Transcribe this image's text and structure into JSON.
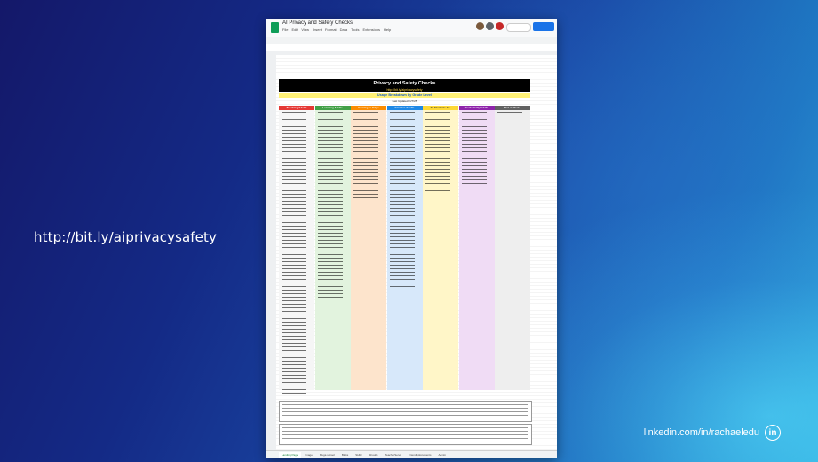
{
  "slide": {
    "link_text": "http://bit.ly/aiprivacysafety",
    "linkedin_text": "linkedin.com/in/rachaeledu",
    "linkedin_icon": "in"
  },
  "spreadsheet": {
    "doc_title": "AI Privacy and Safety Checks",
    "menu": [
      "File",
      "Edit",
      "View",
      "Insert",
      "Format",
      "Data",
      "Tools",
      "Extensions",
      "Help"
    ],
    "title": "Privacy and Safety Checks",
    "subtitle_link": "http://bit.ly/aiprivacysafety",
    "grade_label": "Usage Breakdown by Grade Level",
    "last_updated": "Last Updated: 1/7/25",
    "columns": [
      {
        "label": "Teaching Adults",
        "color": "#e53935",
        "band": "#f6f6f6"
      },
      {
        "label": "Learning Adults",
        "color": "#43a047",
        "band": "#e2f3de"
      },
      {
        "label": "Coming to Grips",
        "color": "#fb8c00",
        "band": "#fde4cc"
      },
      {
        "label": "Creative Adults",
        "color": "#1e88e5",
        "band": "#d7e8fa"
      },
      {
        "label": "All Students 13+",
        "color": "#fdd835",
        "band": "#fff6c8"
      },
      {
        "label": "Productivity Adults",
        "color": "#8e24aa",
        "band": "#f0dcf5"
      },
      {
        "label": "Not all Tools",
        "color": "#616161",
        "band": "#eeeeee"
      }
    ],
    "created_by_label": "Created by:",
    "how_scores_label": "How Scores Were Determined",
    "tabs": [
      "Landing Page",
      "Image",
      "Mega school",
      "Bloks",
      "SHRI",
      "Shuutle",
      "TeacherServe",
      "Friendlydocuments",
      "Admin"
    ]
  },
  "colors": {
    "link": "#ffffff",
    "share_button": "#1a73e8",
    "title_bar": "#000000"
  }
}
